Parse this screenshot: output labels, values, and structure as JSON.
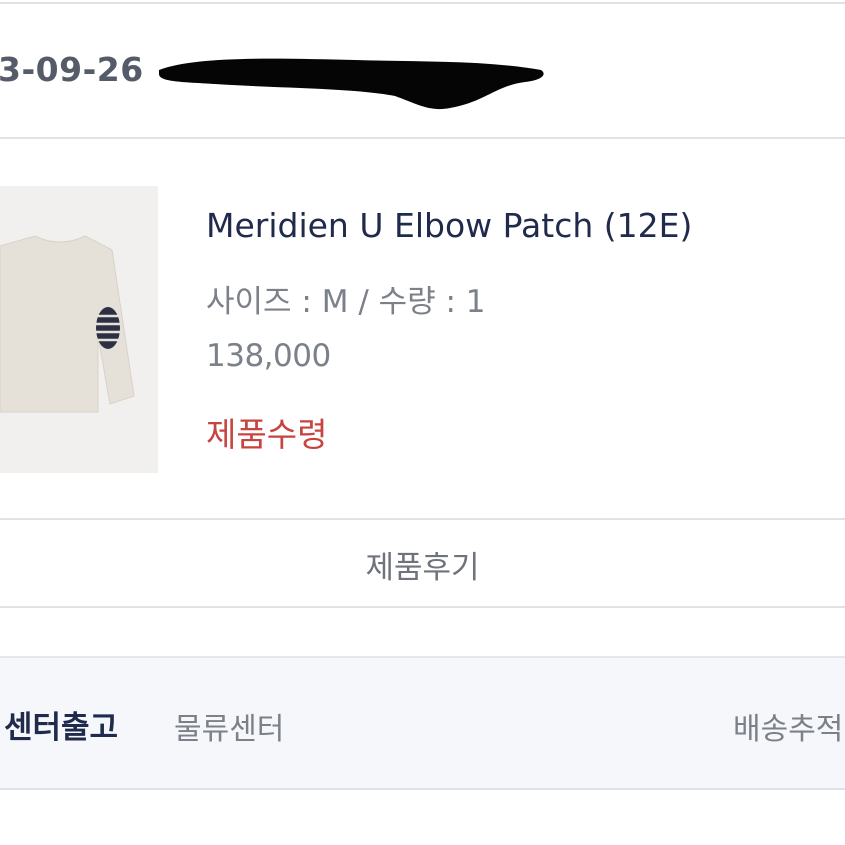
{
  "order": {
    "date": "3-09-26"
  },
  "product": {
    "name": "Meridien U Elbow Patch (12E)",
    "option": "사이즈 : M / 수량 : 1",
    "price": "138,000",
    "status": "제품수령",
    "status_color": "#c8443e",
    "image_icon": "sweater-image"
  },
  "actions": {
    "review_label": "제품후기"
  },
  "shipping": {
    "type": "센터출고",
    "origin": "물류센터",
    "track_label": "배송추적"
  },
  "colors": {
    "primary_text": "#1f2a4c",
    "muted_text": "#7b8089",
    "divider": "#dfe2e7",
    "panel_bg": "#f5f7fa"
  }
}
